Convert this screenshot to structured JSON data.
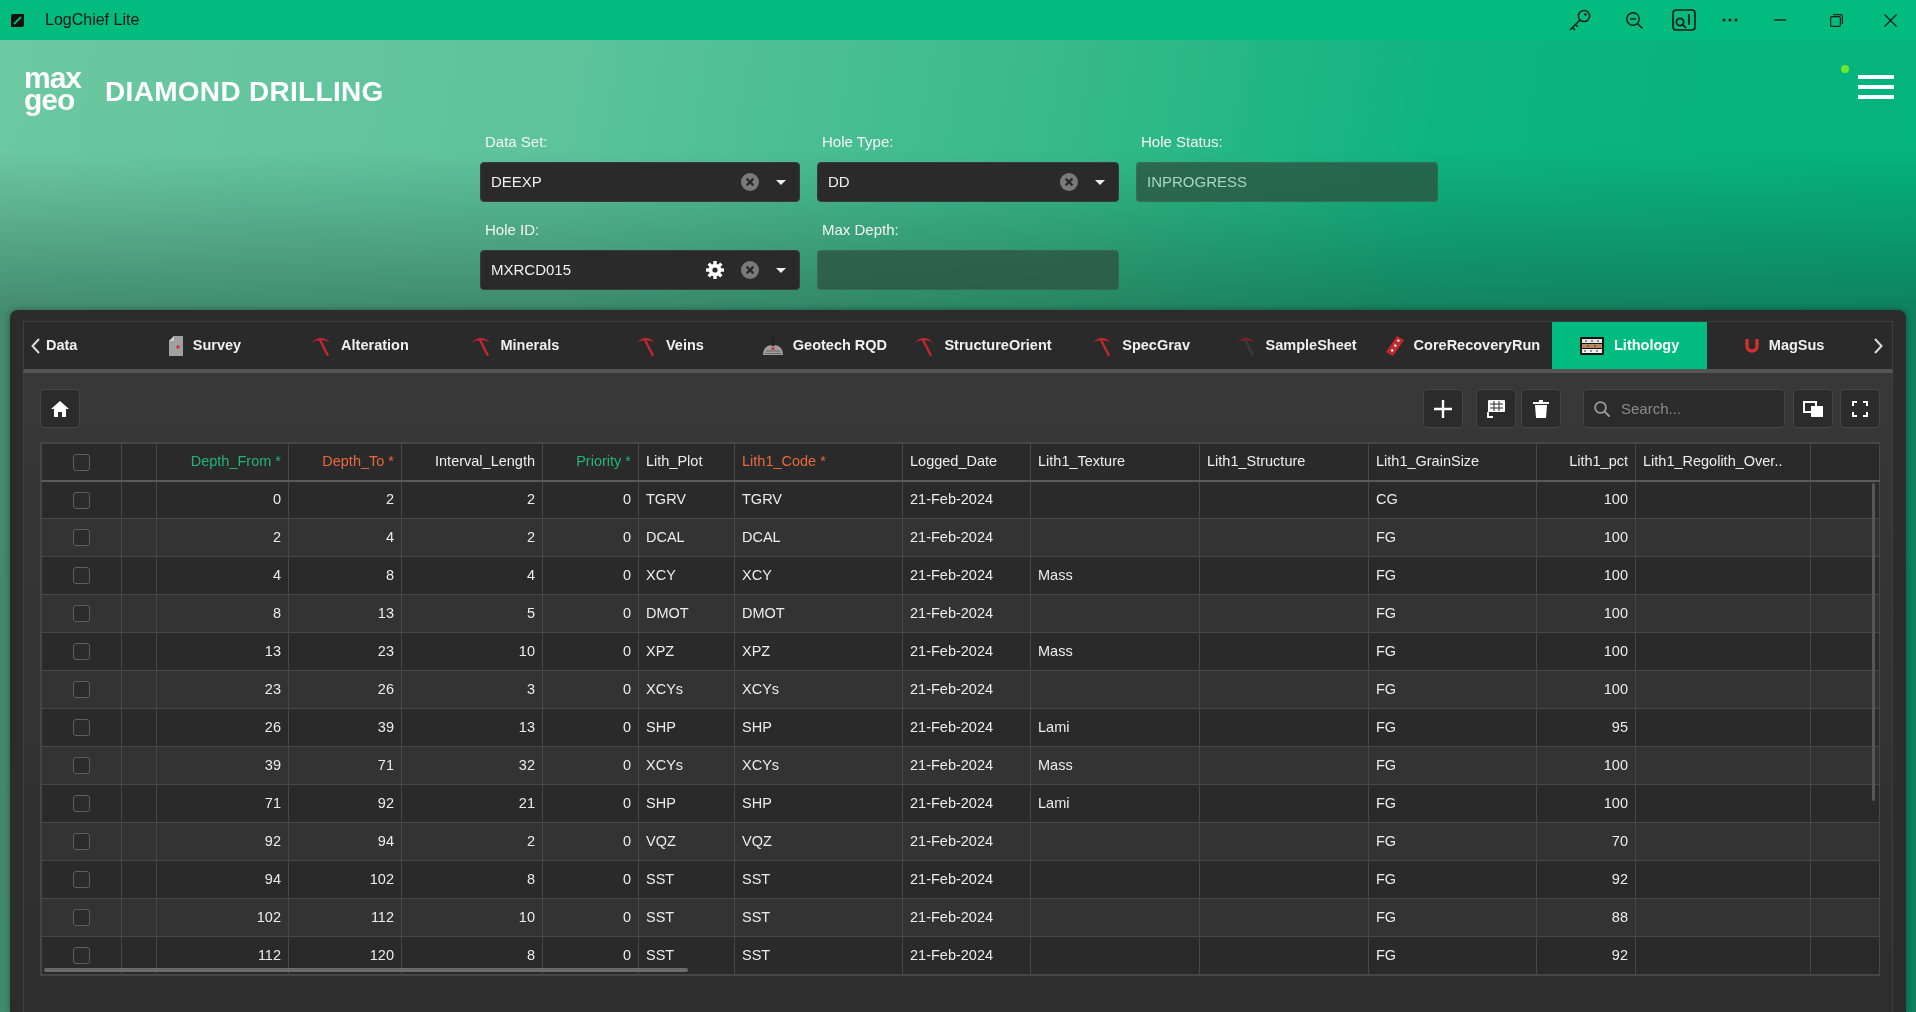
{
  "window": {
    "title": "LogChief Lite"
  },
  "header": {
    "logo": [
      "max",
      "geo"
    ],
    "title": "DIAMOND DRILLING",
    "status_dot": {
      "on": true
    }
  },
  "form": {
    "fields": [
      {
        "label": "Data Set:",
        "value": "DEEXP",
        "kind": "select"
      },
      {
        "label": "Hole Type:",
        "value": "DD",
        "kind": "select"
      },
      {
        "label": "Hole Status:",
        "value": "INPROGRESS",
        "kind": "readonly"
      },
      {
        "label": "Hole ID:",
        "value": "MXRCD015",
        "kind": "select_settings"
      },
      {
        "label": "Max Depth:",
        "kind": "readonly"
      }
    ]
  },
  "tabs": [
    {
      "label": "Data",
      "selected": false
    },
    {
      "label": "Survey",
      "selected": false
    },
    {
      "label": "Alteration",
      "selected": false
    },
    {
      "label": "Minerals",
      "selected": false
    },
    {
      "label": "Veins",
      "selected": false
    },
    {
      "label": "Geotech RQD",
      "selected": false
    },
    {
      "label": "StructureOrient",
      "selected": false
    },
    {
      "label": "SpecGrav",
      "selected": false
    },
    {
      "label": "SampleSheet",
      "selected": false
    },
    {
      "label": "CoreRecoveryRun",
      "selected": false
    },
    {
      "label": "Lithology",
      "selected": true
    },
    {
      "label": "MagSus",
      "selected": false
    }
  ],
  "toolbar": {
    "search": {
      "placeholder": "Search..."
    }
  },
  "table": {
    "select_all": {
      "checked": false
    },
    "columns": [
      {
        "label": "Depth_From *",
        "kind": "number",
        "color": "#22b47c"
      },
      {
        "label": "Depth_To *",
        "kind": "number",
        "color": "#e8693c"
      },
      {
        "label": "Interval_Length",
        "kind": "number"
      },
      {
        "label": "Priority *",
        "kind": "number",
        "color": "#22b47c"
      },
      {
        "label": "Lith_Plot",
        "kind": "text"
      },
      {
        "label": "Lith1_Code *",
        "kind": "text",
        "color": "#e8693c"
      },
      {
        "label": "Logged_Date",
        "kind": "text"
      },
      {
        "label": "Lith1_Texture",
        "kind": "text"
      },
      {
        "label": "Lith1_Structure",
        "kind": "text"
      },
      {
        "label": "Lith1_GrainSize",
        "kind": "text"
      },
      {
        "label": "Lith1_pct",
        "kind": "number"
      },
      {
        "label": "Lith1_Regolith_Over..",
        "kind": "text"
      }
    ],
    "rows": [
      {
        "checked": false,
        "cells": [
          "0",
          "2",
          "2",
          "0",
          "TGRV",
          "TGRV",
          "21-Feb-2024",
          null,
          null,
          "CG",
          "100",
          null
        ]
      },
      {
        "checked": false,
        "cells": [
          "2",
          "4",
          "2",
          "0",
          "DCAL",
          "DCAL",
          "21-Feb-2024",
          null,
          null,
          "FG",
          "100",
          null
        ]
      },
      {
        "checked": false,
        "cells": [
          "4",
          "8",
          "4",
          "0",
          "XCY",
          "XCY",
          "21-Feb-2024",
          "Mass",
          null,
          "FG",
          "100",
          null
        ]
      },
      {
        "checked": false,
        "cells": [
          "8",
          "13",
          "5",
          "0",
          "DMOT",
          "DMOT",
          "21-Feb-2024",
          null,
          null,
          "FG",
          "100",
          null
        ]
      },
      {
        "checked": false,
        "cells": [
          "13",
          "23",
          "10",
          "0",
          "XPZ",
          "XPZ",
          "21-Feb-2024",
          "Mass",
          null,
          "FG",
          "100",
          null
        ]
      },
      {
        "checked": false,
        "cells": [
          "23",
          "26",
          "3",
          "0",
          "XCYs",
          "XCYs",
          "21-Feb-2024",
          null,
          null,
          "FG",
          "100",
          null
        ]
      },
      {
        "checked": false,
        "cells": [
          "26",
          "39",
          "13",
          "0",
          "SHP",
          "SHP",
          "21-Feb-2024",
          "Lami",
          null,
          "FG",
          "95",
          null
        ]
      },
      {
        "checked": false,
        "cells": [
          "39",
          "71",
          "32",
          "0",
          "XCYs",
          "XCYs",
          "21-Feb-2024",
          "Mass",
          null,
          "FG",
          "100",
          null
        ]
      },
      {
        "checked": false,
        "cells": [
          "71",
          "92",
          "21",
          "0",
          "SHP",
          "SHP",
          "21-Feb-2024",
          "Lami",
          null,
          "FG",
          "100",
          null
        ]
      },
      {
        "checked": false,
        "cells": [
          "92",
          "94",
          "2",
          "0",
          "VQZ",
          "VQZ",
          "21-Feb-2024",
          null,
          null,
          "FG",
          "70",
          null
        ]
      },
      {
        "checked": false,
        "cells": [
          "94",
          "102",
          "8",
          "0",
          "SST",
          "SST",
          "21-Feb-2024",
          null,
          null,
          "FG",
          "92",
          null
        ]
      },
      {
        "checked": false,
        "cells": [
          "102",
          "112",
          "10",
          "0",
          "SST",
          "SST",
          "21-Feb-2024",
          null,
          null,
          "FG",
          "88",
          null
        ]
      },
      {
        "checked": false,
        "cells": [
          "112",
          "120",
          "8",
          "0",
          "SST",
          "SST",
          "21-Feb-2024",
          null,
          null,
          "FG",
          "92",
          null
        ]
      }
    ]
  }
}
